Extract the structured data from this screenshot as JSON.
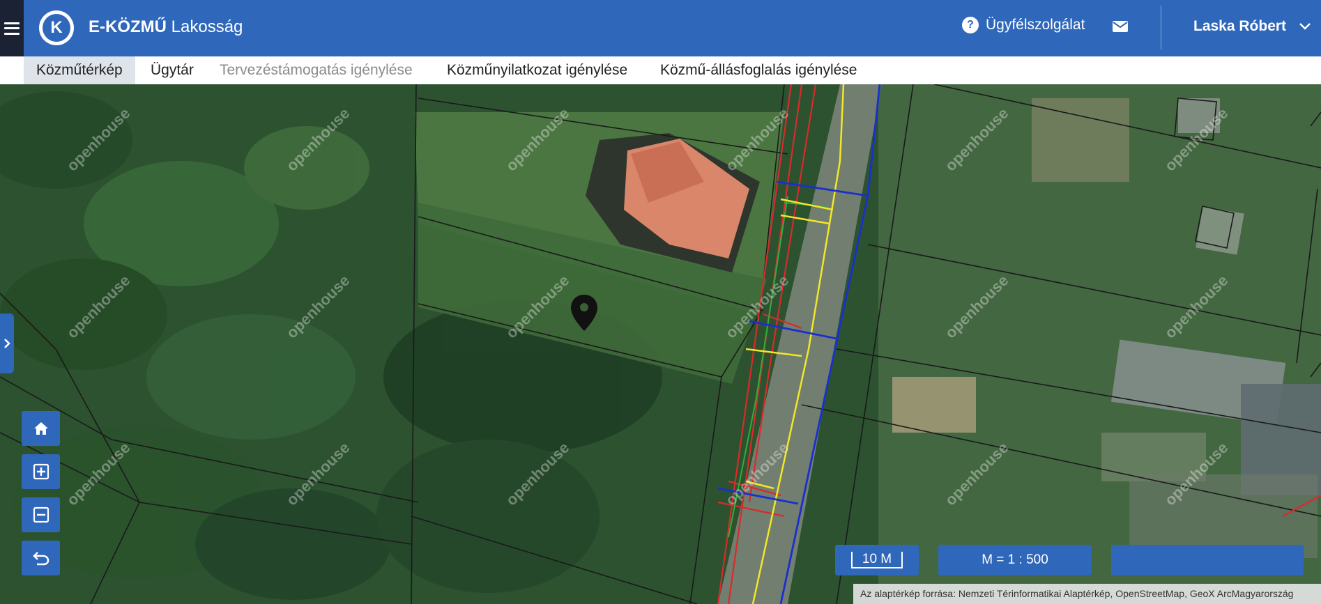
{
  "header": {
    "logo_letter": "K",
    "brand_bold": "E-KÖZMŰ",
    "brand_light": "Lakosság",
    "support_label": "Ügyfélszolgálat",
    "user_name": "Laska Róbert"
  },
  "nav": {
    "tabs": [
      {
        "label": "Közműtérkép",
        "state": "active"
      },
      {
        "label": "Ügytár",
        "state": "normal"
      },
      {
        "label": "Tervezéstámogatás igénylése",
        "state": "disabled"
      },
      {
        "label": "Közműnyilatkozat igénylése",
        "state": "normal"
      },
      {
        "label": "Közmű-állásfoglalás igénylése",
        "state": "normal"
      }
    ]
  },
  "map": {
    "scale_bar": "10 M",
    "scale_ratio": "M = 1 : 500",
    "attribution": "Az alaptérkép forrása: Nemzeti Térinformatikai Alaptérkép, OpenStreetMap, GeoX ArcMagyarország",
    "watermark": "openhouse",
    "controls": [
      "home-icon",
      "zoom-in-icon",
      "zoom-out-icon",
      "undo-icon"
    ]
  },
  "colors": {
    "primary": "#2f67bb",
    "topbar_dark": "#1a2233",
    "utility_red": "#d92b2b",
    "utility_blue": "#1a2fd0",
    "utility_yellow": "#f2e62a",
    "utility_green": "#2fae3a"
  }
}
